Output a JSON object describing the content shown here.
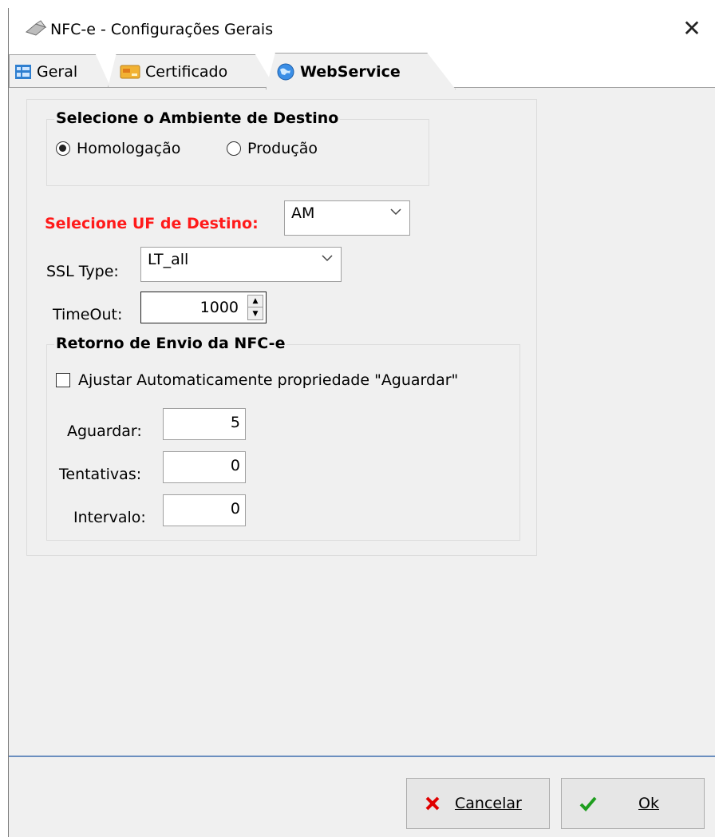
{
  "window": {
    "title": "NFC-e - Configurações Gerais",
    "close_glyph": "✕"
  },
  "tabs": [
    {
      "label": "Geral",
      "icon": "grid-icon",
      "active": false
    },
    {
      "label": "Certificado",
      "icon": "card-icon",
      "active": false
    },
    {
      "label": "WebService",
      "icon": "globe-icon",
      "active": true
    }
  ],
  "ambiente": {
    "title": "Selecione o Ambiente de Destino",
    "options": [
      {
        "label": "Homologação",
        "checked": true
      },
      {
        "label": "Produção",
        "checked": false
      }
    ]
  },
  "uf": {
    "label": "Selecione UF de Destino:",
    "value": "AM",
    "label_color": "#ff1a1a"
  },
  "ssl": {
    "label": "SSL Type:",
    "value": "LT_all"
  },
  "timeout": {
    "label": "TimeOut:",
    "value": "1000"
  },
  "retorno": {
    "title": "Retorno de Envio da NFC-e",
    "checkbox_label": "Ajustar Automaticamente propriedade \"Aguardar\"",
    "checkbox_checked": false,
    "fields": [
      {
        "label": "Aguardar:",
        "value": "5"
      },
      {
        "label": "Tentativas:",
        "value": "0"
      },
      {
        "label": "Intervalo:",
        "value": "0"
      }
    ]
  },
  "buttons": {
    "cancel": {
      "label": "Cancelar",
      "color": "#e00000"
    },
    "ok": {
      "label": "Ok",
      "color": "#1f9e1f"
    }
  }
}
